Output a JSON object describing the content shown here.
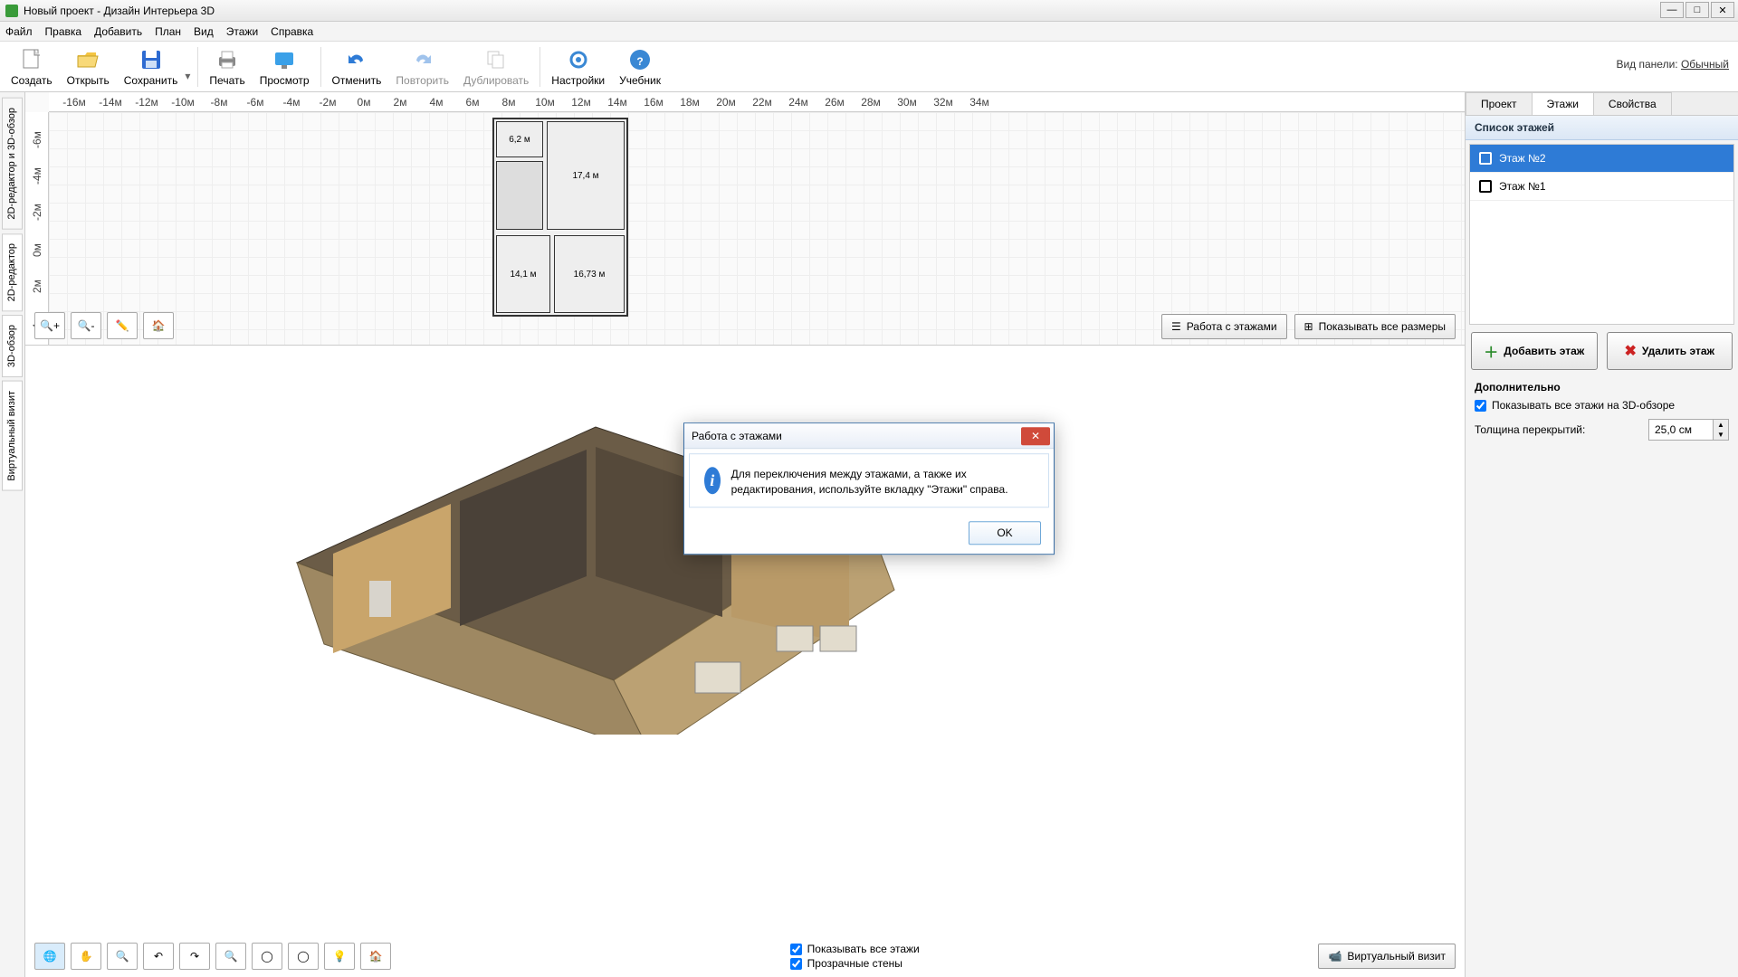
{
  "title": "Новый проект - Дизайн Интерьера 3D",
  "menubar": [
    "Файл",
    "Правка",
    "Добавить",
    "План",
    "Вид",
    "Этажи",
    "Справка"
  ],
  "toolbar": {
    "create": "Создать",
    "open": "Открыть",
    "save": "Сохранить",
    "print": "Печать",
    "preview": "Просмотр",
    "undo": "Отменить",
    "redo": "Повторить",
    "duplicate": "Дублировать",
    "settings": "Настройки",
    "tutorial": "Учебник"
  },
  "view_panel": {
    "label": "Вид панели:",
    "value": "Обычный"
  },
  "left_tabs": [
    "2D-редактор и 3D-обзор",
    "2D-редактор",
    "3D-обзор",
    "Виртуальный визит"
  ],
  "ruler_h": [
    "-16м",
    "-14м",
    "-12м",
    "-10м",
    "-8м",
    "-6м",
    "-4м",
    "-2м",
    "0м",
    "2м",
    "4м",
    "6м",
    "8м",
    "10м",
    "12м",
    "14м",
    "16м",
    "18м",
    "20м",
    "22м",
    "24м",
    "26м",
    "28м",
    "30м",
    "32м",
    "34м"
  ],
  "ruler_v": [
    "-6м",
    "-4м",
    "-2м",
    "0м",
    "2м",
    "4м"
  ],
  "rooms": {
    "r1": "6,2 м",
    "r2": "17,4 м",
    "r3": "14,1 м",
    "r4": "16,73 м"
  },
  "twod_right": {
    "floors": "Работа с этажами",
    "dims": "Показывать все размеры"
  },
  "threed_checks": {
    "all": "Показывать все этажи",
    "trans": "Прозрачные стены"
  },
  "virtual_visit": "Виртуальный визит",
  "right": {
    "tabs": [
      "Проект",
      "Этажи",
      "Свойства"
    ],
    "list_header": "Список этажей",
    "floors": [
      "Этаж №2",
      "Этаж №1"
    ],
    "add": "Добавить этаж",
    "del": "Удалить этаж",
    "extra_title": "Дополнительно",
    "show_all_3d": "Показывать все этажи на 3D-обзоре",
    "thickness_label": "Толщина перекрытий:",
    "thickness_value": "25,0 см"
  },
  "dialog": {
    "title": "Работа с этажами",
    "text": "Для переключения между этажами, а также их редактирования, используйте вкладку \"Этажи\" справа.",
    "ok": "OK"
  }
}
